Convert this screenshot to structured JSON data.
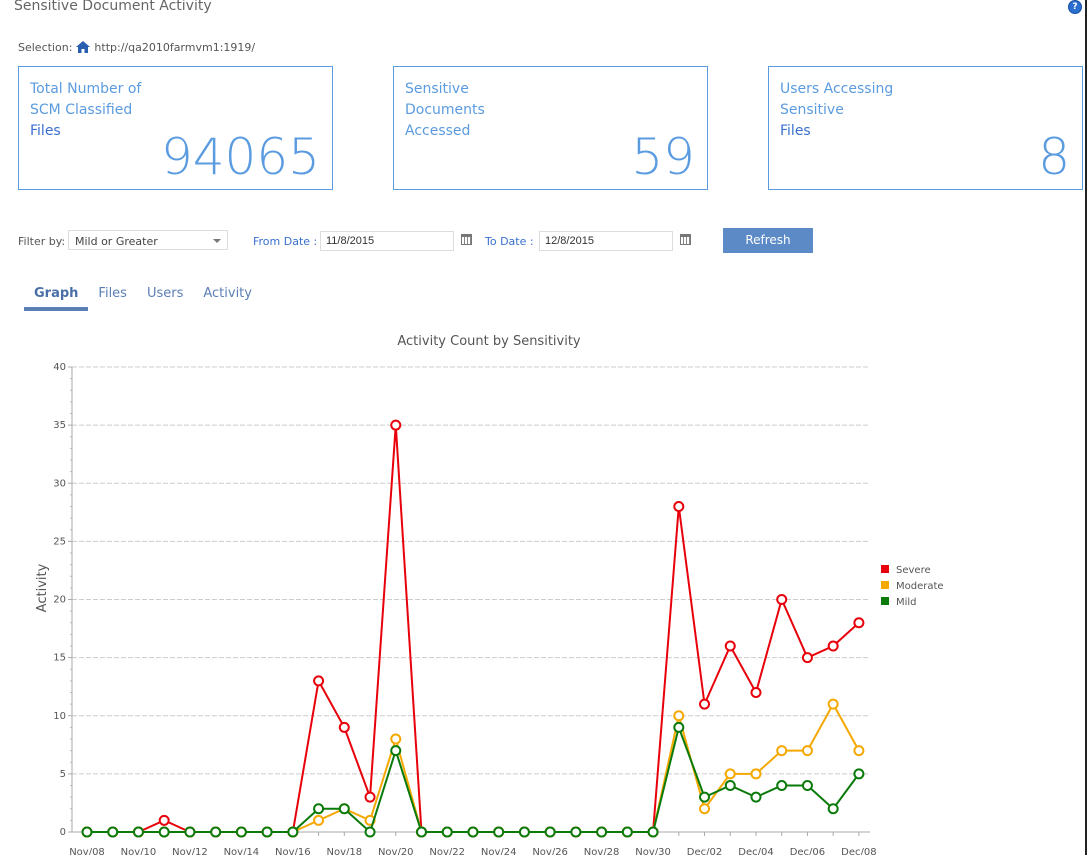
{
  "app": {
    "title": "Sensitive Document Activity",
    "help_icon": "help-icon"
  },
  "selection": {
    "label": "Selection:",
    "icon": "home-icon",
    "url": "http://qa2010farmvm1:1919/"
  },
  "cards": [
    {
      "label_lines": [
        "Total Number of",
        "SCM Classified",
        "Files"
      ],
      "value": "94065"
    },
    {
      "label_lines": [
        "Sensitive",
        "Documents",
        "Accessed"
      ],
      "value": "59"
    },
    {
      "label_lines": [
        "Users Accessing",
        "Sensitive",
        "Files"
      ],
      "value": "8"
    }
  ],
  "filters": {
    "filter_label": "Filter by:",
    "filter_value": "Mild or Greater",
    "from_label": "From Date :",
    "from_value": "11/8/2015",
    "to_label": "To Date :",
    "to_value": "12/8/2015",
    "refresh_label": "Refresh"
  },
  "tabs": [
    {
      "label": "Graph",
      "active": true
    },
    {
      "label": "Files",
      "active": false
    },
    {
      "label": "Users",
      "active": false
    },
    {
      "label": "Activity",
      "active": false
    }
  ],
  "chart_data": {
    "type": "line",
    "title": "Activity Count by Sensitivity",
    "xlabel": "",
    "ylabel": "Activity",
    "ylim": [
      0,
      40
    ],
    "yticks": [
      0,
      5,
      10,
      15,
      20,
      25,
      30,
      35,
      40
    ],
    "grid": true,
    "legend_position": "right",
    "x": [
      "Nov/08",
      "Nov/09",
      "Nov/10",
      "Nov/11",
      "Nov/12",
      "Nov/13",
      "Nov/14",
      "Nov/15",
      "Nov/16",
      "Nov/17",
      "Nov/18",
      "Nov/19",
      "Nov/20",
      "Nov/21",
      "Nov/22",
      "Nov/23",
      "Nov/24",
      "Nov/25",
      "Nov/26",
      "Nov/27",
      "Nov/28",
      "Nov/29",
      "Nov/30",
      "Dec/01",
      "Dec/02",
      "Dec/03",
      "Dec/04",
      "Dec/05",
      "Dec/06",
      "Dec/07",
      "Dec/08"
    ],
    "xtick_labels": [
      "Nov/08",
      "Nov/10",
      "Nov/12",
      "Nov/14",
      "Nov/16",
      "Nov/18",
      "Nov/20",
      "Nov/22",
      "Nov/24",
      "Nov/26",
      "Nov/28",
      "Nov/30",
      "Dec/02",
      "Dec/04",
      "Dec/06",
      "Dec/08"
    ],
    "series": [
      {
        "name": "Severe",
        "color": "#e8000b",
        "values": [
          0,
          0,
          0,
          1,
          0,
          0,
          0,
          0,
          0,
          13,
          9,
          3,
          35,
          0,
          0,
          0,
          0,
          0,
          0,
          0,
          0,
          0,
          0,
          28,
          11,
          16,
          12,
          20,
          15,
          16,
          18
        ]
      },
      {
        "name": "Moderate",
        "color": "#f5a800",
        "values": [
          0,
          0,
          0,
          0,
          0,
          0,
          0,
          0,
          0,
          1,
          2,
          1,
          8,
          0,
          0,
          0,
          0,
          0,
          0,
          0,
          0,
          0,
          0,
          10,
          2,
          5,
          5,
          7,
          7,
          11,
          7
        ]
      },
      {
        "name": "Mild",
        "color": "#0a7a0a",
        "values": [
          0,
          0,
          0,
          0,
          0,
          0,
          0,
          0,
          0,
          2,
          2,
          0,
          7,
          0,
          0,
          0,
          0,
          0,
          0,
          0,
          0,
          0,
          0,
          9,
          3,
          4,
          3,
          4,
          4,
          2,
          5
        ]
      }
    ]
  }
}
